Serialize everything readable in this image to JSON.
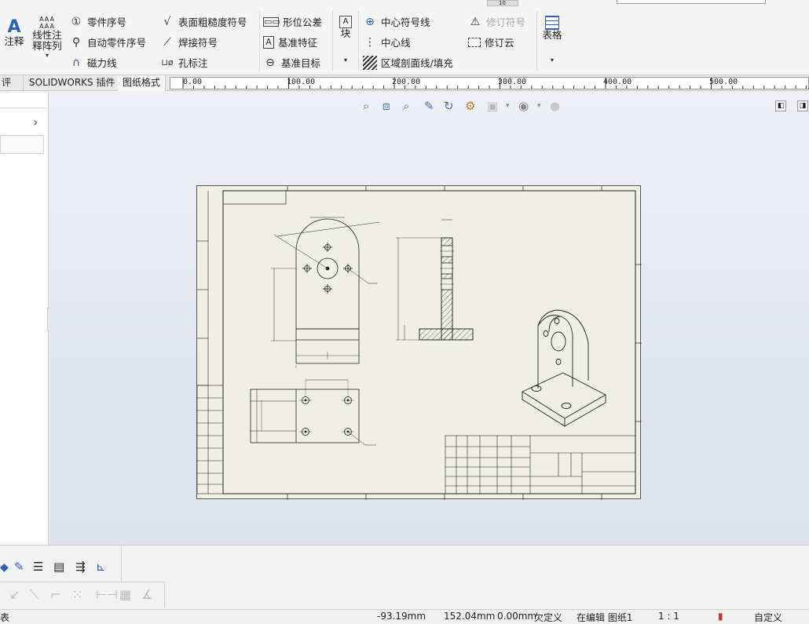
{
  "ribbon": {
    "annotate": "注释",
    "linear_note_line1": "线性注",
    "linear_note_line2": "释阵列",
    "balloon": "零件序号",
    "auto_balloon": "自动零件序号",
    "magnetic_line": "磁力线",
    "surface_finish": "表面粗糙度符号",
    "weld_symbol": "焊接符号",
    "hole_callout": "孔标注",
    "gtol": "形位公差",
    "datum_feature": "基准特征",
    "datum_target": "基准目标",
    "block": "块",
    "center_mark": "中心符号线",
    "centerline": "中心线",
    "area_hatch": "区域剖面线/填充",
    "revision_symbol": "修订符号",
    "revision_cloud": "修订云",
    "table": "表格",
    "top_field": "10"
  },
  "tabs": {
    "evaluate": "评估",
    "addins": "SOLIDWORKS 插件",
    "sheet_format": "图纸格式"
  },
  "ruler": {
    "labels": [
      "0.00",
      "100.00",
      "200.00",
      "300.00",
      "400.00",
      "500.00"
    ]
  },
  "status": {
    "left": "表",
    "x": "-93.19mm",
    "y": "152.04mm",
    "z": "0.00mm",
    "state": "欠定义",
    "editing": "在编辑 图纸1",
    "scale": "1 : 1",
    "custom": "自定义"
  }
}
